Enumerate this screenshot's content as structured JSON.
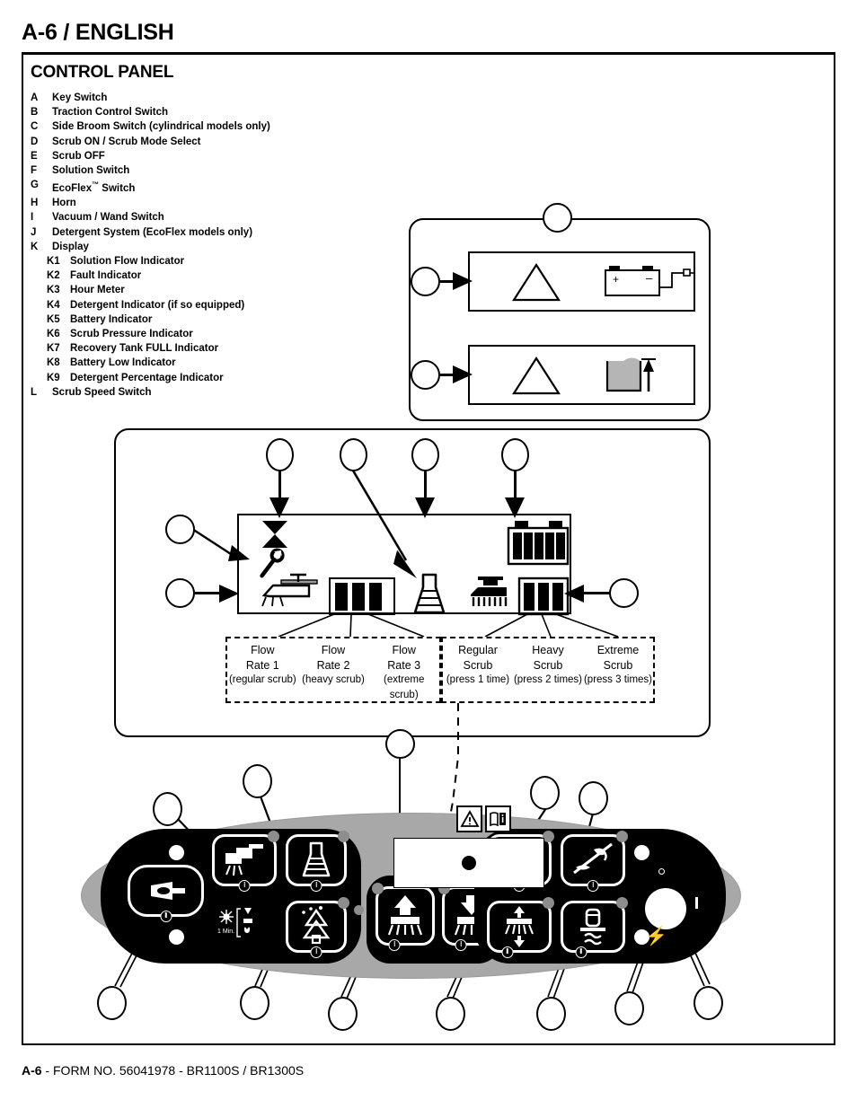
{
  "header": {
    "title": "A-6 / ENGLISH"
  },
  "legend": {
    "title": "CONTROL PANEL",
    "items": [
      {
        "key": "A",
        "label": "Key Switch",
        "sub": false
      },
      {
        "key": "B",
        "label": "Traction Control Switch",
        "sub": false
      },
      {
        "key": "C",
        "label": "Side Broom Switch (cylindrical models only)",
        "sub": false
      },
      {
        "key": "D",
        "label": "Scrub ON / Scrub Mode Select",
        "sub": false
      },
      {
        "key": "E",
        "label": "Scrub OFF",
        "sub": false
      },
      {
        "key": "F",
        "label": "Solution Switch",
        "sub": false
      },
      {
        "key": "G",
        "label": "EcoFlex™ Switch",
        "sub": false
      },
      {
        "key": "H",
        "label": "Horn",
        "sub": false
      },
      {
        "key": "I",
        "label": "Vacuum / Wand Switch",
        "sub": false
      },
      {
        "key": "J",
        "label": "Detergent System (EcoFlex models only)",
        "sub": false
      },
      {
        "key": "K",
        "label": "Display",
        "sub": false
      },
      {
        "key": "K1",
        "label": "Solution Flow Indicator",
        "sub": true
      },
      {
        "key": "K2",
        "label": "Fault Indicator",
        "sub": true
      },
      {
        "key": "K3",
        "label": "Hour Meter",
        "sub": true
      },
      {
        "key": "K4",
        "label": "Detergent Indicator (if so equipped)",
        "sub": true
      },
      {
        "key": "K5",
        "label": "Battery Indicator",
        "sub": true
      },
      {
        "key": "K6",
        "label": "Scrub Pressure Indicator",
        "sub": true
      },
      {
        "key": "K7",
        "label": "Recovery Tank FULL Indicator",
        "sub": true
      },
      {
        "key": "K8",
        "label": "Battery Low Indicator",
        "sub": true
      },
      {
        "key": "K9",
        "label": "Detergent Percentage Indicator",
        "sub": true
      },
      {
        "key": "L",
        "label": "Scrub Speed Switch",
        "sub": false
      }
    ]
  },
  "warning_panel": {
    "rows": [
      {
        "icons": [
          "warning-triangle-icon",
          "battery-charge-icon"
        ]
      },
      {
        "icons": [
          "warning-triangle-icon",
          "recovery-tank-full-icon"
        ]
      }
    ]
  },
  "display_panel": {
    "icons": [
      "fault-wrench-icon",
      "solution-flow-icon",
      "flow-rate-bars-icon",
      "detergent-flask-icon",
      "scrub-brush-icon",
      "scrub-pressure-bars-icon",
      "battery-level-icon"
    ]
  },
  "flow_labels": {
    "left_group": [
      {
        "line1": "Flow",
        "line2": "Rate 1",
        "note": "(regular scrub)"
      },
      {
        "line1": "Flow",
        "line2": "Rate 2",
        "note": "(heavy scrub)"
      },
      {
        "line1": "Flow",
        "line2": "Rate 3",
        "note": "(extreme scrub)"
      }
    ],
    "right_group": [
      {
        "line1": "Regular",
        "line2": "Scrub",
        "note": "(press 1 time)"
      },
      {
        "line1": "Heavy",
        "line2": "Scrub",
        "note": "(press 2 times)"
      },
      {
        "line1": "Extreme",
        "line2": "Scrub",
        "note": "(press 3 times)"
      }
    ]
  },
  "control_panel": {
    "timer_label": "1 Min.",
    "buttons": [
      {
        "name": "horn-button",
        "icon": "horn-icon"
      },
      {
        "name": "solution-switch-button",
        "icon": "faucet-spray-icon"
      },
      {
        "name": "detergent-system-button",
        "icon": "flask-icon"
      },
      {
        "name": "ecoflex-switch-button",
        "icon": "ecoflex-tree-icon"
      },
      {
        "name": "scrub-on-button",
        "icon": "brush-up-arrow-icon"
      },
      {
        "name": "scrub-off-button",
        "icon": "brush-down-arrow-icon"
      },
      {
        "name": "vacuum-wand-button",
        "icon": "vacuum-wand-off-icon"
      },
      {
        "name": "side-broom-button",
        "icon": "side-broom-off-icon"
      },
      {
        "name": "scrub-speed-button",
        "icon": "brush-pressure-icon"
      },
      {
        "name": "traction-control-button",
        "icon": "traction-control-icon"
      }
    ],
    "key_switch": {
      "name": "key-switch",
      "icon": "key-switch-icon"
    },
    "warning_labels": [
      "warning-triangle-icon",
      "read-manual-icon"
    ]
  },
  "footer": {
    "page": "A-6",
    "text": " - FORM NO. 56041978 - BR1100S / BR1300S"
  },
  "colors": {
    "panel_gray": "#a8a8a8",
    "pod_black": "#000000",
    "led_gray": "#8d8d8d",
    "ink": "#000000"
  }
}
